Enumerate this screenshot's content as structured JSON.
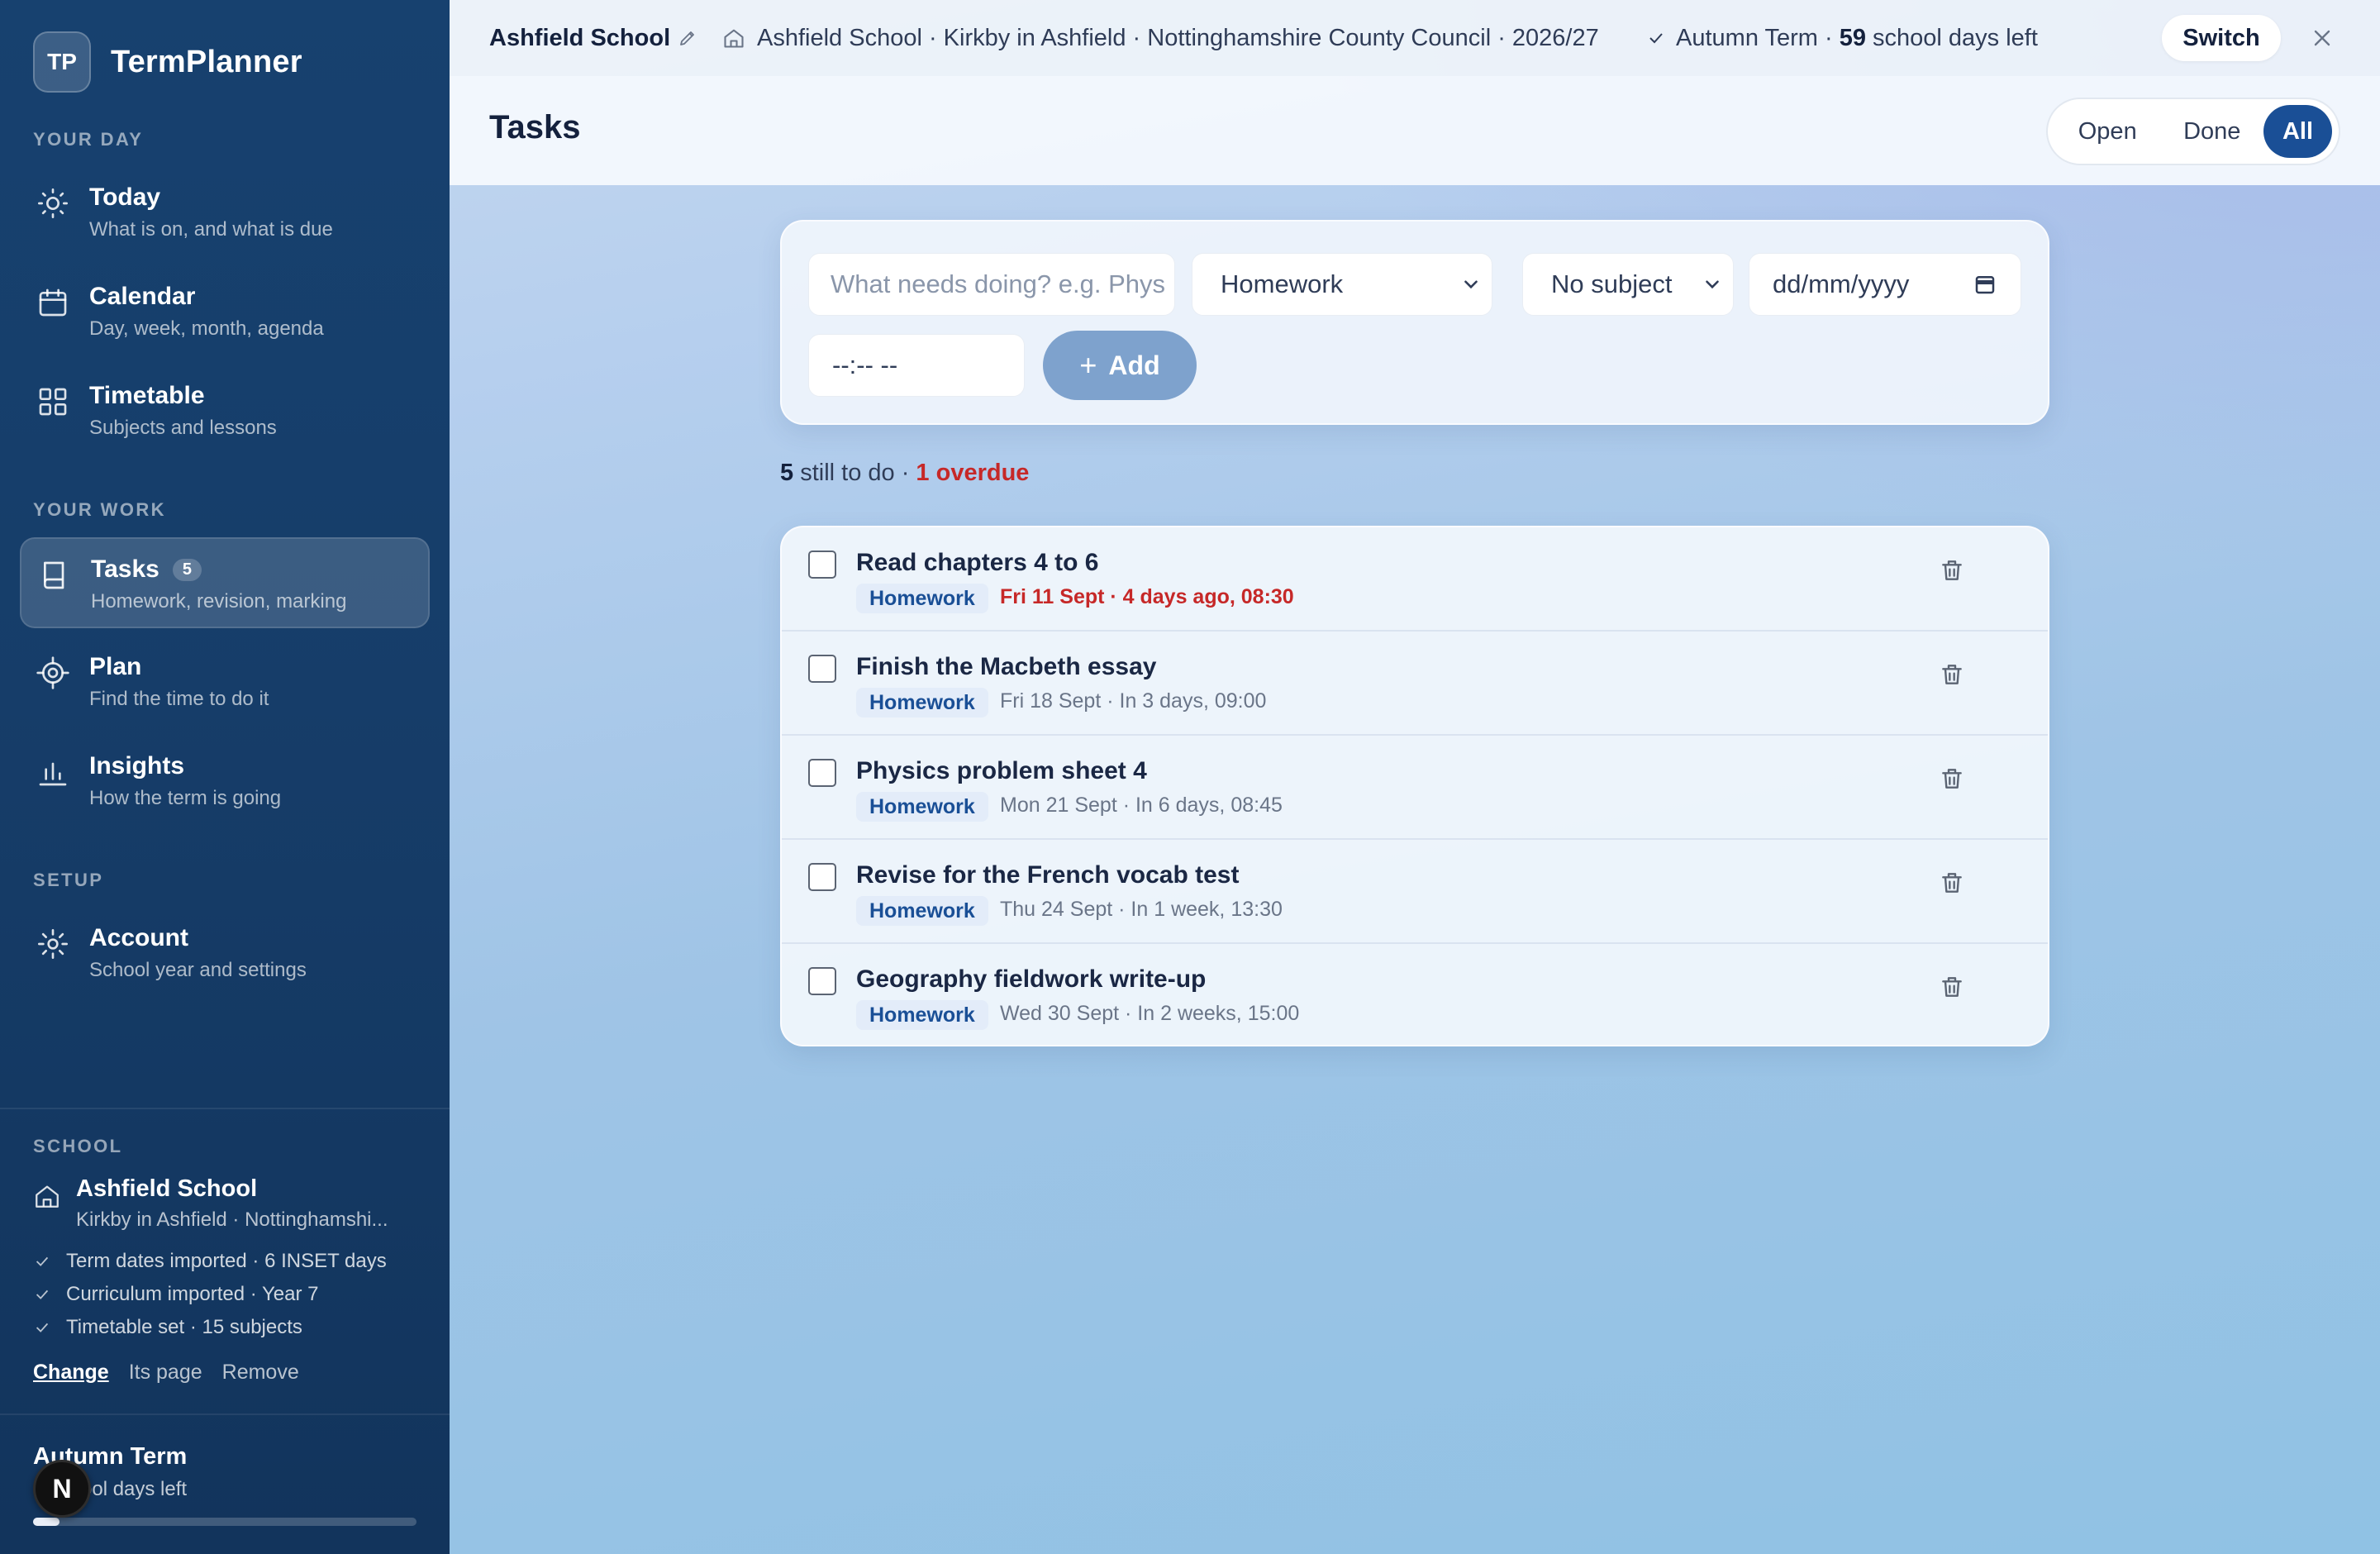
{
  "brand": {
    "logo": "TP",
    "name": "TermPlanner"
  },
  "sidebar": {
    "sections": {
      "day": "YOUR DAY",
      "work": "YOUR WORK",
      "setup": "SETUP",
      "school": "SCHOOL"
    },
    "items": [
      {
        "icon": "sun-icon",
        "title": "Today",
        "sub": "What is on, and what is due"
      },
      {
        "icon": "calendar-icon",
        "title": "Calendar",
        "sub": "Day, week, month, agenda"
      },
      {
        "icon": "grid-icon",
        "title": "Timetable",
        "sub": "Subjects and lessons"
      },
      {
        "icon": "book-icon",
        "title": "Tasks",
        "sub": "Homework, revision, marking",
        "badge": "5"
      },
      {
        "icon": "target-icon",
        "title": "Plan",
        "sub": "Find the time to do it"
      },
      {
        "icon": "bar-chart-icon",
        "title": "Insights",
        "sub": "How the term is going"
      },
      {
        "icon": "gear-icon",
        "title": "Account",
        "sub": "School year and settings"
      }
    ],
    "school": {
      "name": "Ashfield School",
      "location": "Kirkby in Ashfield · Nottinghamshi...",
      "checks": [
        "Term dates imported · 6 INSET days",
        "Curriculum imported · Year 7",
        "Timetable set · 15 subjects"
      ],
      "links": {
        "change": "Change",
        "page": "Its page",
        "remove": "Remove"
      }
    },
    "term": {
      "title": "Autumn Term",
      "sub": "ool days left",
      "progress": 0.07
    },
    "avatar": "N"
  },
  "topbar": {
    "school": "Ashfield School",
    "detail": "Ashfield School · Kirkby in Ashfield · Nottinghamshire County Council · 2026/27",
    "term_prefix": "Autumn Term · ",
    "days_left": "59",
    "term_suffix": " school days left",
    "switch": "Switch"
  },
  "page": {
    "title": "Tasks",
    "filters": {
      "open": "Open",
      "done": "Done",
      "all": "All",
      "selected": "All"
    }
  },
  "form": {
    "task_placeholder": "What needs doing? e.g. Phys",
    "type": "Homework",
    "subject": "No subject",
    "date": "dd/mm/yyyy",
    "time": "--:-- --",
    "add": "Add"
  },
  "summary": {
    "count": "5",
    "count_text": " still to do · ",
    "overdue": "1 overdue"
  },
  "colors": {
    "accent": "#1a4f96",
    "overdue": "#c62828",
    "sidebar": "#163d69"
  },
  "tasks": [
    {
      "title": "Read chapters 4 to 6",
      "tag": "Homework",
      "due": "Fri 11 Sept · 4 days ago, 08:30",
      "overdue": true
    },
    {
      "title": "Finish the Macbeth essay",
      "tag": "Homework",
      "due": "Fri 18 Sept · In 3 days, 09:00",
      "overdue": false
    },
    {
      "title": "Physics problem sheet 4",
      "tag": "Homework",
      "due": "Mon 21 Sept · In 6 days, 08:45",
      "overdue": false
    },
    {
      "title": "Revise for the French vocab test",
      "tag": "Homework",
      "due": "Thu 24 Sept · In 1 week, 13:30",
      "overdue": false
    },
    {
      "title": "Geography fieldwork write-up",
      "tag": "Homework",
      "due": "Wed 30 Sept · In 2 weeks, 15:00",
      "overdue": false
    }
  ]
}
